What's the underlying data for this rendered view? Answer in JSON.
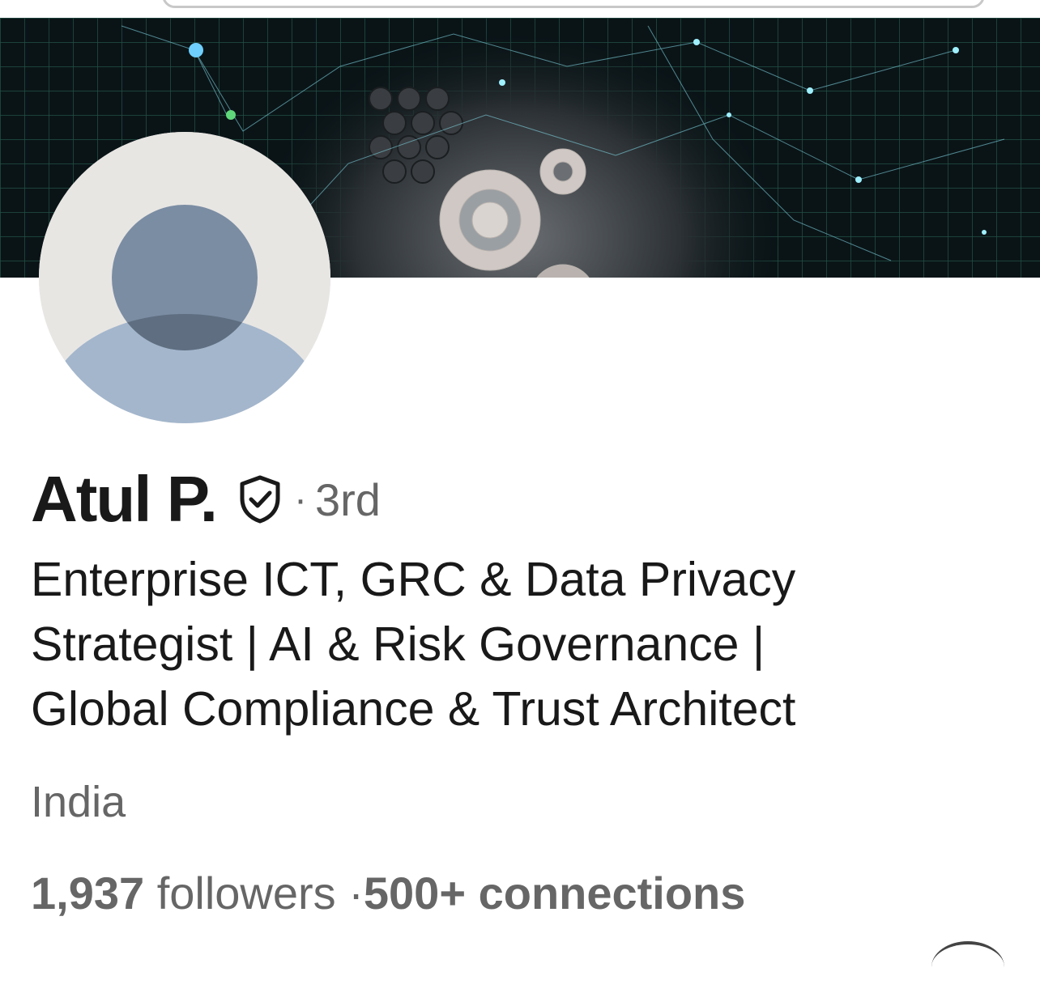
{
  "profile": {
    "name": "Atul P.",
    "verification_icon": "shield-check-icon",
    "separator": "·",
    "connection_degree": "3rd",
    "headline_lines": [
      "Enterprise ICT, GRC & Data Privacy",
      "Strategist | AI & Risk Governance |",
      "Global Compliance & Trust Architect"
    ],
    "location": "India",
    "followers_count": "1,937",
    "followers_label": "followers",
    "stats_separator": "·",
    "connections": "500+ connections"
  },
  "icons": {
    "avatar": "default-person-avatar",
    "verify": "shield-check-icon"
  },
  "colors": {
    "text_primary": "#191919",
    "text_secondary": "#666666",
    "avatar_bg": "#e8e6e3",
    "avatar_head": "#7b8da3",
    "avatar_body": "#a3b6cc",
    "banner_bg": "#0a1417"
  }
}
